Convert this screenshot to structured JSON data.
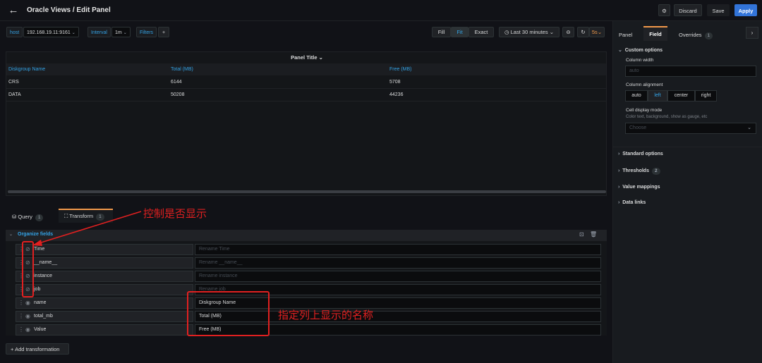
{
  "header": {
    "title": "Oracle Views / Edit Panel",
    "discard": "Discard",
    "save": "Save",
    "apply": "Apply"
  },
  "variables": {
    "host_label": "host",
    "host_value": "192.168.19.11:9161",
    "interval_label": "Interval",
    "interval_value": "1m",
    "filters_label": "Filters",
    "add": "+"
  },
  "toolbar": {
    "fill": "Fill",
    "fit": "Fit",
    "exact": "Exact",
    "time_range": "Last 30 minutes",
    "refresh": "5s"
  },
  "panel": {
    "title": "Panel Title",
    "columns": [
      "Diskgroup Name",
      "Total (MB)",
      "Free (MB)"
    ],
    "rows": [
      [
        "CRS",
        "6144",
        "5708"
      ],
      [
        "DATA",
        "50208",
        "44236"
      ]
    ]
  },
  "tabs": {
    "query": "Query",
    "query_count": "1",
    "transform": "Transform",
    "transform_count": "1"
  },
  "organize": {
    "title": "Organize fields",
    "fields": [
      {
        "name": "Time",
        "placeholder": "Rename Time",
        "value": ""
      },
      {
        "name": "__name__",
        "placeholder": "Rename __name__",
        "value": ""
      },
      {
        "name": "instance",
        "placeholder": "Rename instance",
        "value": ""
      },
      {
        "name": "job",
        "placeholder": "Rename job",
        "value": ""
      },
      {
        "name": "name",
        "placeholder": "",
        "value": "Diskgroup Name"
      },
      {
        "name": "total_mb",
        "placeholder": "",
        "value": "Total (MB)"
      },
      {
        "name": "Value",
        "placeholder": "",
        "value": "Free (MB)"
      }
    ],
    "add_transformation": "Add transformation"
  },
  "right": {
    "tabs": [
      "Panel",
      "Field",
      "Overrides"
    ],
    "overrides_count": "1",
    "custom_options": "Custom options",
    "column_width": "Column width",
    "column_width_placeholder": "auto",
    "column_alignment": "Column alignment",
    "alignment_options": [
      "auto",
      "left",
      "center",
      "right"
    ],
    "cell_display_mode": "Cell display mode",
    "cell_display_desc": "Color text, background, show as gauge, etc",
    "choose_placeholder": "Choose",
    "sections": [
      "Standard options",
      "Thresholds",
      "Value mappings",
      "Data links"
    ],
    "thresholds_count": "2"
  },
  "annotations": {
    "show_hide": "控制是否显示",
    "column_names": "指定列上显示的名称"
  },
  "colors": {
    "accent": "#3274d9",
    "link": "#33a2e5",
    "tab_active": "#f2994a",
    "annotation": "#e02020"
  }
}
